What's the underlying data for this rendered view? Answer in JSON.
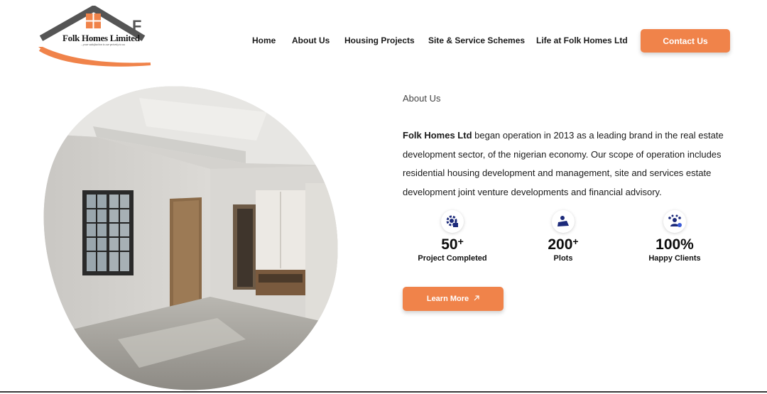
{
  "brand": {
    "name": "Folk Homes Limited",
    "tagline": "...your satisfaction is our priority to us",
    "accent": "#f0834a"
  },
  "nav": {
    "items": [
      "Home",
      "About Us",
      "Housing Projects",
      "Site & Service Schemes",
      "Life at Folk Homes Ltd"
    ],
    "cta": "Contact Us"
  },
  "about": {
    "label": "About Us",
    "company": "Folk Homes Ltd",
    "text": " began operation in 2013 as a leading brand in the real estate development sector, of the nigerian economy. Our scope of operation includes residential housing development and management, site and services estate development joint venture developments and financial advisory."
  },
  "stats": [
    {
      "value": "50",
      "suffix": "+",
      "label": "Project Completed",
      "icon": "gear-house-icon"
    },
    {
      "value": "200",
      "suffix": "+",
      "label": "Plots",
      "icon": "land-plot-icon"
    },
    {
      "value": "100%",
      "suffix": "",
      "label": "Happy Clients",
      "icon": "happy-clients-icon"
    }
  ],
  "learn_more": {
    "label": "Learn More",
    "icon": "arrow-up-right-icon"
  },
  "image": {
    "subject": "interior-room-photo"
  }
}
